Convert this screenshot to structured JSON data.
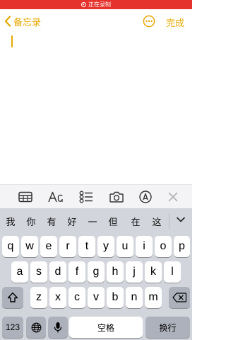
{
  "status_bar": {
    "recording_label": "正在录制"
  },
  "nav": {
    "back_label": "备忘录",
    "done_label": "完成"
  },
  "editor": {
    "content": ""
  },
  "candidates": [
    "我",
    "你",
    "有",
    "好",
    "一",
    "但",
    "在",
    "这"
  ],
  "keyboard": {
    "row1": [
      "q",
      "w",
      "e",
      "r",
      "t",
      "y",
      "u",
      "i",
      "o",
      "p"
    ],
    "row2": [
      "a",
      "s",
      "d",
      "f",
      "g",
      "h",
      "j",
      "k",
      "l"
    ],
    "row3": [
      "z",
      "x",
      "c",
      "v",
      "b",
      "n",
      "m"
    ],
    "numbers_label": "123",
    "space_label": "空格",
    "return_label": "换行"
  },
  "colors": {
    "accent": "#e6a800",
    "recording": "#e5322d",
    "keyboard_bg": "#d3d5dc"
  }
}
